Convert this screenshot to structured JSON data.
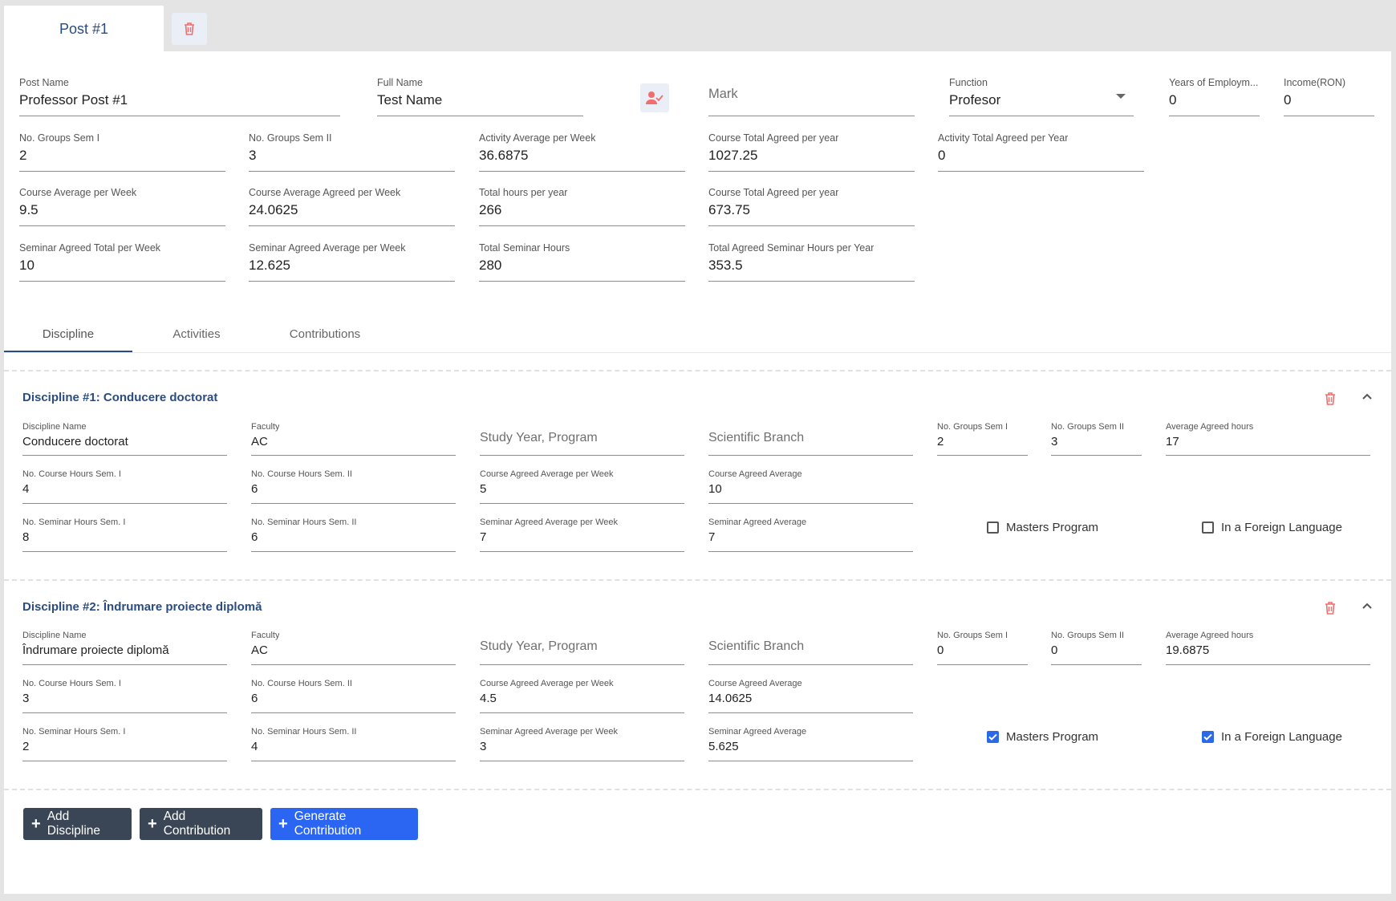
{
  "post_tab": {
    "label": "Post #1"
  },
  "post": {
    "post_name": {
      "label": "Post Name",
      "value": "Professor Post #1"
    },
    "full_name": {
      "label": "Full Name",
      "value": "Test Name"
    },
    "mark": {
      "placeholder": "Mark"
    },
    "function": {
      "label": "Function",
      "value": "Profesor"
    },
    "years": {
      "label": "Years of Employm...",
      "value": "0"
    },
    "income": {
      "label": "Income(RON)",
      "value": "0"
    },
    "groups_sem1": {
      "label": "No. Groups Sem I",
      "value": "2"
    },
    "groups_sem2": {
      "label": "No. Groups Sem II",
      "value": "3"
    },
    "activity_avg_week": {
      "label": "Activity Average per Week",
      "value": "36.6875"
    },
    "course_total_agreed_year_a": {
      "label": "Course Total Agreed per year",
      "value": "1027.25"
    },
    "activity_total_agreed_year": {
      "label": "Activity Total Agreed per Year",
      "value": "0"
    },
    "course_avg_week": {
      "label": "Course Average per Week",
      "value": "9.5"
    },
    "course_avg_agreed_week": {
      "label": "Course Average Agreed per Week",
      "value": "24.0625"
    },
    "total_hours_year": {
      "label": "Total hours per year",
      "value": "266"
    },
    "course_total_agreed_year_b": {
      "label": "Course Total Agreed per year",
      "value": "673.75"
    },
    "seminar_agreed_total_week": {
      "label": "Seminar Agreed Total per Week",
      "value": "10"
    },
    "seminar_agreed_avg_week": {
      "label": "Seminar Agreed Average per Week",
      "value": "12.625"
    },
    "total_seminar_hours": {
      "label": "Total Seminar Hours",
      "value": "280"
    },
    "total_agreed_seminar_year": {
      "label": "Total Agreed Seminar Hours per Year",
      "value": "353.5"
    }
  },
  "tabs": [
    "Discipline",
    "Activities",
    "Contributions"
  ],
  "disciplines": [
    {
      "title": "Discipline #1: Conducere doctorat",
      "name": {
        "label": "Discipline Name",
        "value": "Conducere doctorat"
      },
      "faculty": {
        "label": "Faculty",
        "value": "AC"
      },
      "study_year": {
        "placeholder": "Study Year, Program"
      },
      "branch": {
        "placeholder": "Scientific Branch"
      },
      "groups_sem1": {
        "label": "No. Groups Sem I",
        "value": "2"
      },
      "groups_sem2": {
        "label": "No. Groups Sem II",
        "value": "3"
      },
      "avg_agreed_hours": {
        "label": "Average Agreed hours",
        "value": "17"
      },
      "course_hours_sem1": {
        "label": "No. Course Hours Sem. I",
        "value": "4"
      },
      "course_hours_sem2": {
        "label": "No. Course Hours Sem. II",
        "value": "6"
      },
      "course_agreed_avg_week": {
        "label": "Course Agreed Average per Week",
        "value": "5"
      },
      "course_agreed_avg": {
        "label": "Course Agreed Average",
        "value": "10"
      },
      "seminar_hours_sem1": {
        "label": "No. Seminar Hours Sem. I",
        "value": "8"
      },
      "seminar_hours_sem2": {
        "label": "No. Seminar Hours Sem. II",
        "value": "6"
      },
      "seminar_agreed_avg_week": {
        "label": "Seminar Agreed Average per Week",
        "value": "7"
      },
      "seminar_agreed_avg": {
        "label": "Seminar Agreed Average",
        "value": "7"
      },
      "masters": {
        "label": "Masters Program",
        "checked": false
      },
      "foreign": {
        "label": "In a Foreign Language",
        "checked": false
      }
    },
    {
      "title": "Discipline #2: Îndrumare proiecte diplomă",
      "name": {
        "label": "Discipline Name",
        "value": "Îndrumare proiecte diplomă"
      },
      "faculty": {
        "label": "Faculty",
        "value": "AC"
      },
      "study_year": {
        "placeholder": "Study Year, Program"
      },
      "branch": {
        "placeholder": "Scientific Branch"
      },
      "groups_sem1": {
        "label": "No. Groups Sem I",
        "value": "0"
      },
      "groups_sem2": {
        "label": "No. Groups Sem II",
        "value": "0"
      },
      "avg_agreed_hours": {
        "label": "Average Agreed hours",
        "value": "19.6875"
      },
      "course_hours_sem1": {
        "label": "No. Course Hours Sem. I",
        "value": "3"
      },
      "course_hours_sem2": {
        "label": "No. Course Hours Sem. II",
        "value": "6"
      },
      "course_agreed_avg_week": {
        "label": "Course Agreed Average per Week",
        "value": "4.5"
      },
      "course_agreed_avg": {
        "label": "Course Agreed Average",
        "value": "14.0625"
      },
      "seminar_hours_sem1": {
        "label": "No. Seminar Hours Sem. I",
        "value": "2"
      },
      "seminar_hours_sem2": {
        "label": "No. Seminar Hours Sem. II",
        "value": "4"
      },
      "seminar_agreed_avg_week": {
        "label": "Seminar Agreed Average per Week",
        "value": "3"
      },
      "seminar_agreed_avg": {
        "label": "Seminar Agreed Average",
        "value": "5.625"
      },
      "masters": {
        "label": "Masters Program",
        "checked": true
      },
      "foreign": {
        "label": "In a Foreign Language",
        "checked": true
      }
    }
  ],
  "buttons": {
    "add_discipline": "Add Discipline",
    "add_contribution": "Add Contribution",
    "generate_contribution": "Generate Contribution"
  },
  "colors": {
    "accent": "#2a4c80",
    "primary": "#2a66f2",
    "dark_button": "#3a4656",
    "danger": "#f26d6d"
  },
  "icons": {
    "trash": "trash-icon",
    "assign_user": "user-check-icon",
    "collapse": "chevron-up-icon",
    "plus": "plus-icon"
  }
}
